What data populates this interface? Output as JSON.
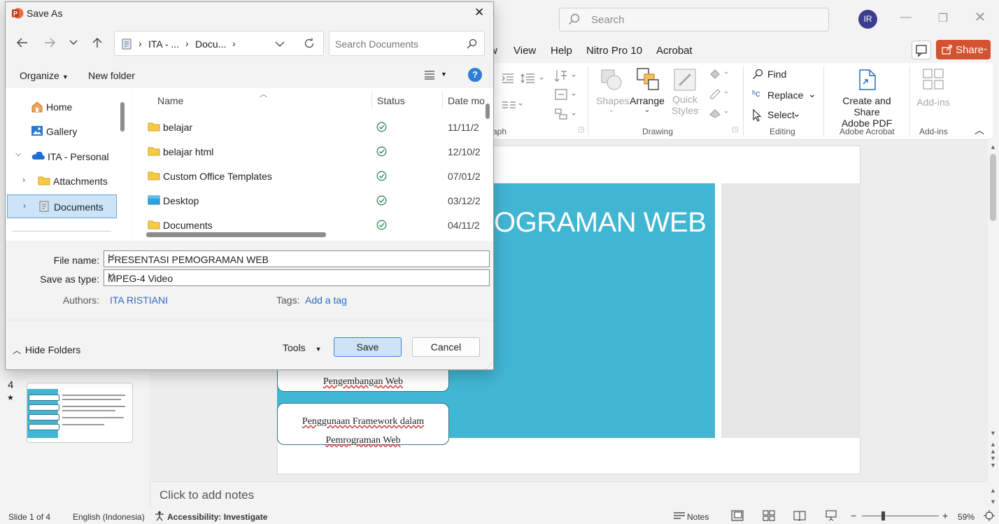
{
  "app": {
    "search_placeholder": "Search",
    "avatar_initials": "IR",
    "menu": [
      "w",
      "View",
      "Help",
      "Nitro Pro 10",
      "Acrobat"
    ],
    "share_label": "Share",
    "ribbon": {
      "paragraph_group_label": "raph",
      "drawing_group_label": "Drawing",
      "editing_group_label": "Editing",
      "adobe_group_label": "Adobe Acrobat",
      "addins_group_label": "Add-ins",
      "shapes_label": "Shapes",
      "arrange_label": "Arrange",
      "quick_styles_label_1": "Quick",
      "quick_styles_label_2": "Styles",
      "find_label": "Find",
      "replace_label": "Replace",
      "select_label": "Select",
      "create_share_label_1": "Create and Share",
      "create_share_label_2": "Adobe PDF",
      "addins_label": "Add-ins"
    },
    "slide": {
      "title_fragment": "OGRAMAN WEB",
      "box1": "Pengembangan Web",
      "box2_line1": "Penggunaan Framework dalam",
      "box2_line2": "Pemrograman Web"
    },
    "thumbnail": {
      "number": "4",
      "star": "★"
    },
    "notes_placeholder": "Click to add notes",
    "status": {
      "slide_counter": "Slide 1 of 4",
      "language": "English (Indonesia)",
      "accessibility": "Accessibility: Investigate",
      "notes": "Notes",
      "zoom": "59%"
    }
  },
  "dialog": {
    "title": "Save As",
    "address": {
      "seg1": "ITA - ...",
      "seg2": "Docu..."
    },
    "search_placeholder": "Search Documents",
    "organize_label": "Organize",
    "new_folder_label": "New folder",
    "nav_items": [
      "Home",
      "Gallery",
      "ITA - Personal",
      "Attachments",
      "Documents"
    ],
    "columns": {
      "name": "Name",
      "status": "Status",
      "date": "Date mo"
    },
    "files": [
      {
        "name": "belajar",
        "date": "11/11/2",
        "type": "folder"
      },
      {
        "name": "belajar html",
        "date": "12/10/2",
        "type": "folder"
      },
      {
        "name": "Custom Office Templates",
        "date": "07/01/2",
        "type": "folder"
      },
      {
        "name": "Desktop",
        "date": "03/12/2",
        "type": "desktop"
      },
      {
        "name": "Documents",
        "date": "04/11/2",
        "type": "folder"
      }
    ],
    "file_name_label": "File name:",
    "file_name_value": "PRESENTASI PEMOGRAMAN WEB",
    "save_type_label": "Save as type:",
    "save_type_value": "MPEG-4 Video",
    "authors_label": "Authors:",
    "authors_value": "ITA RISTIANI",
    "tags_label": "Tags:",
    "tags_value": "Add a tag",
    "hide_folders_label": "Hide Folders",
    "tools_label": "Tools",
    "save_label": "Save",
    "cancel_label": "Cancel"
  },
  "colors": {
    "accent": "#2d6cc2",
    "share": "#d35230",
    "slide_teal": "#41b6d3",
    "sync_green": "#2e8b57"
  }
}
